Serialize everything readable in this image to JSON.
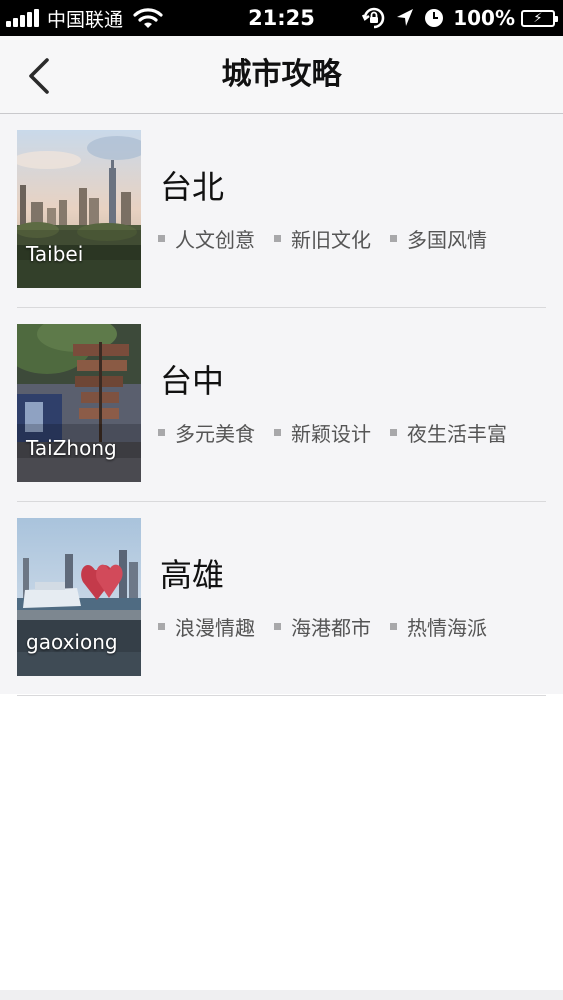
{
  "status_bar": {
    "carrier": "中国联通",
    "time": "21:25",
    "battery": "100%",
    "icons": [
      "signal-icon",
      "wifi-icon",
      "rotation-lock-icon",
      "location-icon",
      "alarm-icon",
      "battery-charging-icon"
    ]
  },
  "nav": {
    "title": "城市攻略",
    "back_icon": "chevron-left-icon"
  },
  "cities": [
    {
      "name": "台北",
      "label": "Taibei",
      "tags": [
        "人文创意",
        "新旧文化",
        "多国风情"
      ]
    },
    {
      "name": "台中",
      "label": "TaiZhong",
      "tags": [
        "多元美食",
        "新颖设计",
        "夜生活丰富"
      ]
    },
    {
      "name": "高雄",
      "label": "gaoxiong",
      "tags": [
        "浪漫情趣",
        "海港都市",
        "热情海派"
      ]
    }
  ],
  "colors": {
    "status_bar_bg": "#000000",
    "nav_bg": "#f7f7f8",
    "list_bg": "#f5f5f7",
    "tag_text": "#555555",
    "tag_bullet": "#a8a8aa"
  }
}
